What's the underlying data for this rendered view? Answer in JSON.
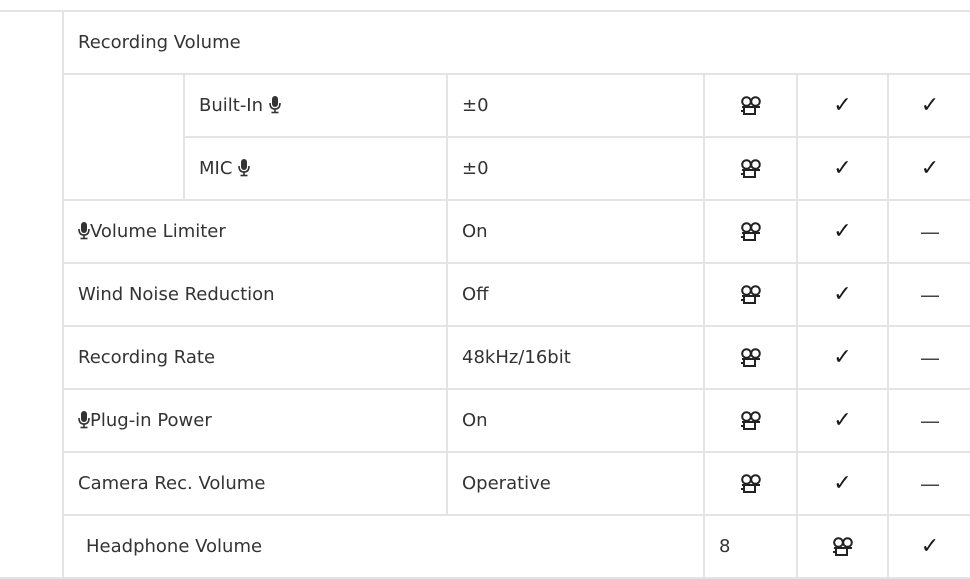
{
  "recording_volume": {
    "label": "Recording Volume",
    "sub_rows": [
      {
        "label": "Built-In",
        "value": "±0",
        "mark_a": "✓",
        "mark_b": "✓"
      },
      {
        "label": "MIC",
        "value": "±0",
        "mark_a": "✓",
        "mark_b": "✓"
      }
    ]
  },
  "rows": [
    {
      "label": "Volume Limiter",
      "mic_prefix": true,
      "value": "On",
      "mark_a": "✓",
      "mark_b": "—"
    },
    {
      "label": "Wind Noise Reduction",
      "mic_prefix": false,
      "value": "Off",
      "mark_a": "✓",
      "mark_b": "—"
    },
    {
      "label": "Recording Rate",
      "mic_prefix": false,
      "value": "48kHz/16bit",
      "mark_a": "✓",
      "mark_b": "—"
    },
    {
      "label": "Plug-in Power",
      "mic_prefix": true,
      "value": "On",
      "mark_a": "✓",
      "mark_b": "—"
    },
    {
      "label": "Camera Rec. Volume",
      "mic_prefix": false,
      "value": "Operative",
      "mark_a": "✓",
      "mark_b": "—"
    }
  ],
  "headphone": {
    "label": "Headphone Volume",
    "value": "8",
    "mark_a": "✓",
    "mark_b": "—"
  },
  "icons": {
    "movie_icon": "movie-camera-icon",
    "mic_icon": "microphone-icon"
  }
}
